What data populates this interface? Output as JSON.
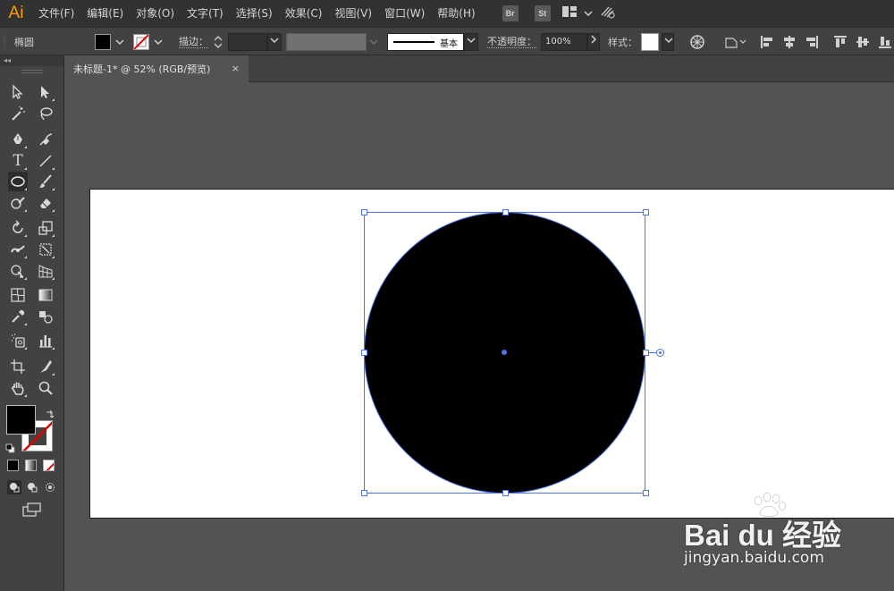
{
  "app": {
    "logo": "Ai"
  },
  "menu": [
    "文件(F)",
    "编辑(E)",
    "对象(O)",
    "文字(T)",
    "选择(S)",
    "效果(C)",
    "视图(V)",
    "窗口(W)",
    "帮助(H)"
  ],
  "menu_badges": [
    "Br",
    "St"
  ],
  "control_bar": {
    "object_label": "椭圆",
    "stroke_label": "描边：",
    "brush_label": "基本",
    "opacity_label": "不透明度：",
    "opacity_value": "100%",
    "style_label": "样式："
  },
  "toolbar": {
    "collapse": "◂◂"
  },
  "document_tab": {
    "title": "未标题-1* @ 52% (RGB/预览)",
    "close": "×"
  },
  "colors": {
    "accent": "#4f74e6",
    "logo": "#ff9a00",
    "fill": "#000000",
    "stroke_none": "#ff0000"
  },
  "watermark": {
    "brand": "Bai du 经验",
    "url": "jingyan.baidu.com"
  }
}
